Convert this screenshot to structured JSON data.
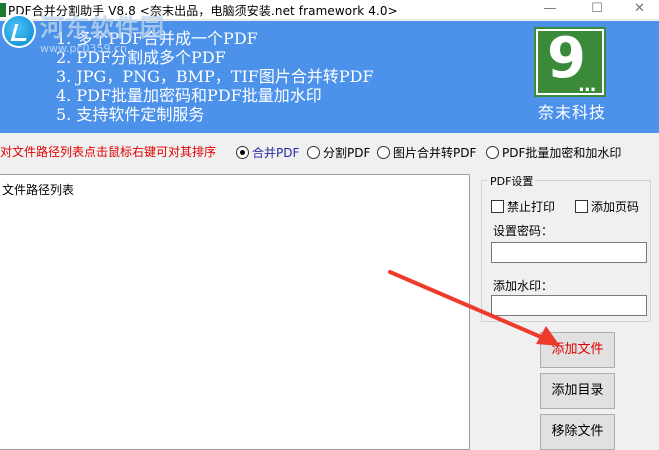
{
  "window": {
    "title": "PDF合并分割助手 V8.8 <奈末出品，电脑须安装.net framework 4.0>",
    "min_glyph": "—",
    "max_glyph": "☐",
    "close_glyph": "✕"
  },
  "watermark": {
    "text": "河东软件园",
    "url": "www.pc0359.cn"
  },
  "banner": {
    "features": [
      "1. 多个PDF合并成一个PDF",
      "2. PDF分割成多个PDF",
      "3. JPG，PNG，BMP，TIF图片合并转PDF",
      "4. PDF批量加密码和PDF批量加水印",
      "5. 支持软件定制服务"
    ],
    "logo_glyph": "9",
    "logo_dots": "...",
    "brand_name": "奈末科技",
    "color": "#4c91ea"
  },
  "mode": {
    "hint": "对文件路径列表点击鼠标右键可对其排序",
    "options": [
      {
        "label": "合并PDF",
        "selected": true
      },
      {
        "label": "分割PDF",
        "selected": false
      },
      {
        "label": "图片合并转PDF",
        "selected": false
      },
      {
        "label": "PDF批量加密和加水印",
        "selected": false
      }
    ]
  },
  "file_list": {
    "header": "文件路径列表"
  },
  "pdf_settings": {
    "title": "PDF设置",
    "disable_print": "禁止打印",
    "add_page_number": "添加页码",
    "password_label": "设置密码：",
    "password_value": "",
    "watermark_label": "添加水印：",
    "watermark_value": ""
  },
  "buttons": {
    "add_file": "添加文件",
    "add_folder": "添加目录",
    "remove_file": "移除文件"
  },
  "colors": {
    "hint_red": "#e00000",
    "annotation_red": "#ef3b2c"
  }
}
